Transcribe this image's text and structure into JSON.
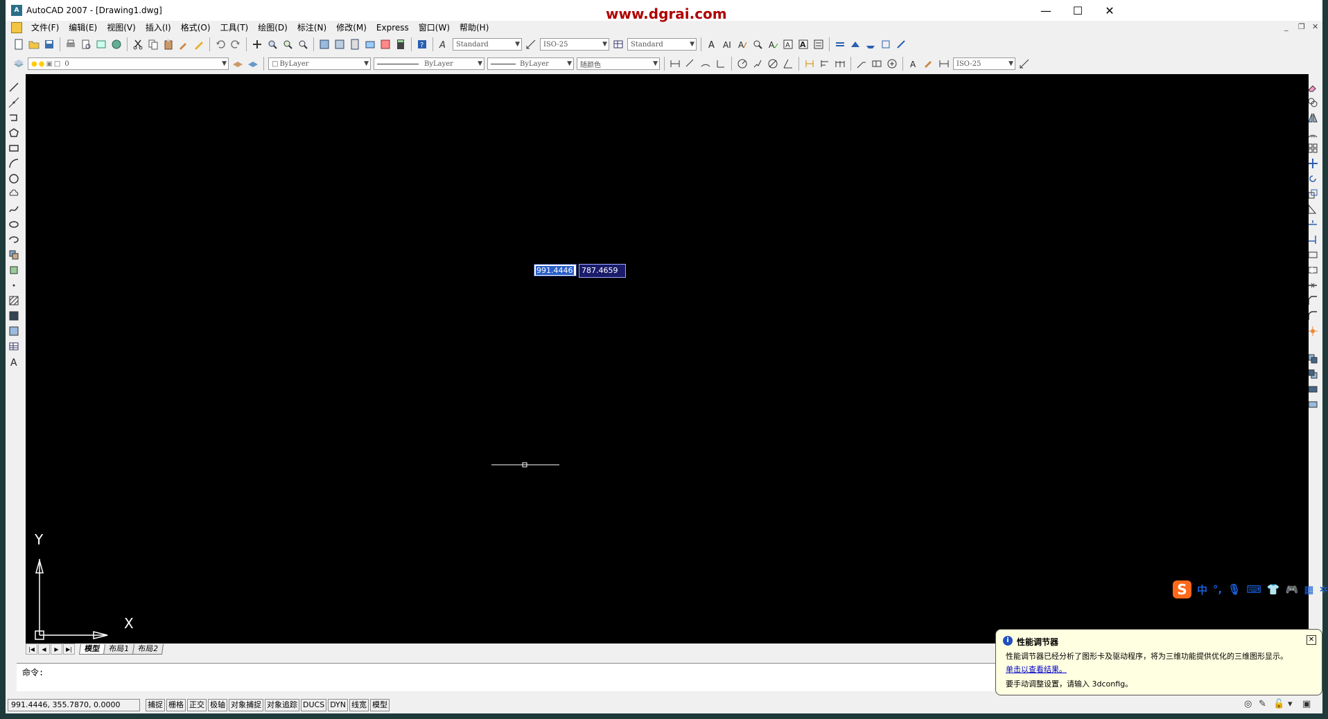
{
  "window": {
    "title": "AutoCAD 2007 - [Drawing1.dwg]",
    "watermark": "www.dgrai.com",
    "controls": {
      "minimize": "—",
      "maximize": "☐",
      "close": "✕"
    },
    "mdi_controls": {
      "minimize": "_",
      "restore": "❐",
      "close": "✕"
    }
  },
  "menu": [
    "文件(F)",
    "编辑(E)",
    "视图(V)",
    "插入(I)",
    "格式(O)",
    "工具(T)",
    "绘图(D)",
    "标注(N)",
    "修改(M)",
    "Express",
    "窗口(W)",
    "帮助(H)"
  ],
  "toolbar1": {
    "text_style": "Standard",
    "dim_style": "ISO-25",
    "table_style": "Standard"
  },
  "toolbar2": {
    "layer": "0",
    "color": "ByLayer",
    "linetype": "ByLayer",
    "lineweight": "ByLayer",
    "plot_style": "随颜色",
    "dim_style2": "ISO-25"
  },
  "canvas": {
    "dyn_input_x": "991.4446",
    "dyn_input_y": "787.4659",
    "ucs_x": "X",
    "ucs_y": "Y"
  },
  "tabs": {
    "nav": [
      "|◀",
      "◀",
      "▶",
      "▶|"
    ],
    "items": [
      "模型",
      "布局1",
      "布局2"
    ]
  },
  "command": {
    "prompt": "命令:"
  },
  "status": {
    "coords": "991.4446,  355.7870, 0.0000",
    "buttons": [
      "捕捉",
      "栅格",
      "正交",
      "极轴",
      "对象捕捉",
      "对象追踪",
      "DUCS",
      "DYN",
      "线宽",
      "模型"
    ]
  },
  "balloon": {
    "title": "性能调节器",
    "line1": "性能调节器已经分析了图形卡及驱动程序，将为三维功能提供优化的三维图形显示。",
    "link": "单击以查看结果。",
    "line3": "要手动调整设置，请输入 3dconfig。",
    "close": "✕",
    "icon": "i"
  },
  "ime": {
    "logo": "S",
    "mode": "中"
  }
}
